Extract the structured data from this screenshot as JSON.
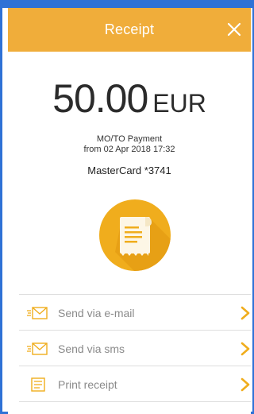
{
  "header": {
    "title": "Receipt",
    "close_icon": "close-icon"
  },
  "payment": {
    "amount": "50.00",
    "currency": "EUR",
    "type": "MO/TO Payment",
    "date": "from 02 Apr 2018 17:32",
    "card": "MasterCard *3741"
  },
  "actions": [
    {
      "label": "Send via e-mail",
      "icon": "envelope-icon"
    },
    {
      "label": "Send via sms",
      "icon": "envelope-icon"
    },
    {
      "label": "Print receipt",
      "icon": "receipt-small-icon"
    }
  ],
  "colors": {
    "header": "#f0ad3a",
    "accent": "#f0ad1d",
    "frame": "#2f72d6"
  }
}
